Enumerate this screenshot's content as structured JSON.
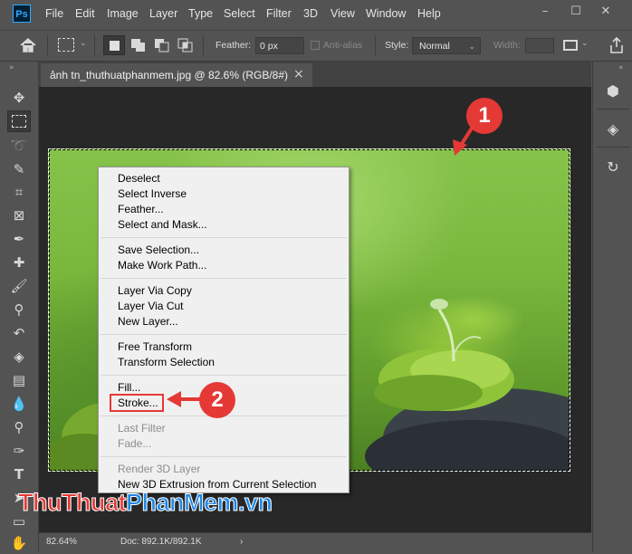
{
  "app": {
    "logo_text": "Ps"
  },
  "menubar": {
    "items": [
      "File",
      "Edit",
      "Image",
      "Layer",
      "Type",
      "Select",
      "Filter",
      "3D",
      "View",
      "Window",
      "Help"
    ]
  },
  "window_controls": {
    "minimize": "–",
    "maximize": "☐",
    "close": "✕"
  },
  "options_bar": {
    "feather_label": "Feather:",
    "feather_value": "0 px",
    "antialias_label": "Anti-alias",
    "style_label": "Style:",
    "style_value": "Normal",
    "width_label": "Width:"
  },
  "document_tab": {
    "title": "ảnh tn_thuthuatphanmem.jpg @ 82.6% (RGB/8#)",
    "close": "×"
  },
  "context_menu": {
    "groups": [
      [
        "Deselect",
        "Select Inverse",
        "Feather...",
        "Select and Mask..."
      ],
      [
        "Save Selection...",
        "Make Work Path..."
      ],
      [
        "Layer Via Copy",
        "Layer Via Cut",
        "New Layer..."
      ],
      [
        "Free Transform",
        "Transform Selection"
      ],
      [
        "Fill...",
        "Stroke..."
      ],
      [
        "Last Filter",
        "Fade..."
      ],
      [
        "Render 3D Layer",
        "New 3D Extrusion from Current Selection"
      ]
    ],
    "disabled": [
      "Last Filter",
      "Fade...",
      "Render 3D Layer"
    ]
  },
  "annotations": {
    "step1": "1",
    "step2": "2",
    "accent": "#e53935"
  },
  "status_bar": {
    "zoom": "82.64%",
    "doc": "Doc: 892.1K/892.1K",
    "arrow": "›"
  },
  "watermark": {
    "part1": "Thu",
    "part2": "Thuat",
    "part3": "PhanMem",
    "part4": ".vn"
  },
  "icons": [
    "move-icon",
    "marquee-icon",
    "lasso-icon",
    "quick-select-icon",
    "crop-icon",
    "frame-icon",
    "eyedropper-icon",
    "healing-icon",
    "brush-icon",
    "stamp-icon",
    "history-brush-icon",
    "eraser-icon",
    "gradient-icon",
    "blur-icon",
    "dodge-icon",
    "pen-icon",
    "type-icon",
    "path-select-icon",
    "shape-icon",
    "hand-icon",
    "zoom-icon"
  ]
}
